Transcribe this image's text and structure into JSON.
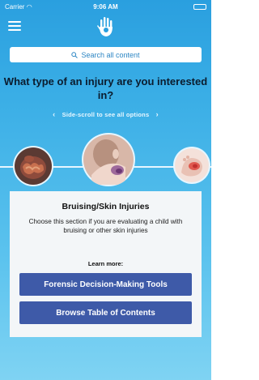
{
  "status_bar": {
    "carrier": "Carrier",
    "time": "9:06 AM"
  },
  "search": {
    "placeholder": "Search all content"
  },
  "headline": "What type of an injury are you interested in?",
  "scroll_hint": {
    "left_chevron": "‹",
    "text": "Side-scroll to see all options",
    "right_chevron": "›"
  },
  "carousel": {
    "items": [
      {
        "icon": "abdominal-organs-icon"
      },
      {
        "icon": "bruised-child-icon",
        "selected": true
      },
      {
        "icon": "injured-foot-icon"
      }
    ]
  },
  "selected_category": {
    "title": "Bruising/Skin Injuries",
    "description": "Choose this section if you are evaluating a child with bruising or other skin injuries",
    "learn_more_label": "Learn more:",
    "buttons": [
      "Forensic Decision-Making Tools",
      "Browse Table of Contents"
    ]
  },
  "colors": {
    "accent": "#3e5aa8",
    "background_top": "#2a9fdf",
    "background_bottom": "#7fd3f3"
  }
}
